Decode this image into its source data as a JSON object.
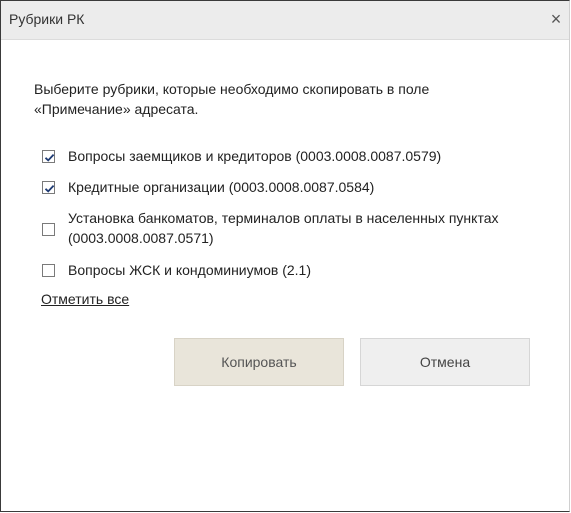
{
  "dialog": {
    "title": "Рубрики РК",
    "close_glyph": "×",
    "intro": "Выберите рубрики, которые необходимо скопировать в поле «Примечание» адресата.",
    "options": [
      {
        "label": "Вопросы заемщиков и кредиторов (0003.0008.0087.0579)",
        "checked": true
      },
      {
        "label": "Кредитные организации (0003.0008.0087.0584)",
        "checked": true
      },
      {
        "label": "Установка банкоматов, терминалов оплаты в населенных пунктах (0003.0008.0087.0571)",
        "checked": false
      },
      {
        "label": "Вопросы ЖСК и кондоминиумов (2.1)",
        "checked": false
      }
    ],
    "select_all_label": "Отметить все",
    "copy_label": "Копировать",
    "cancel_label": "Отмена",
    "icons": {
      "close": "close-icon",
      "check": "checkmark-icon"
    },
    "colors": {
      "titlebar": "#ececec",
      "check": "#1f3b73",
      "copy_bg": "#e9e5da",
      "cancel_bg": "#efefef"
    }
  }
}
